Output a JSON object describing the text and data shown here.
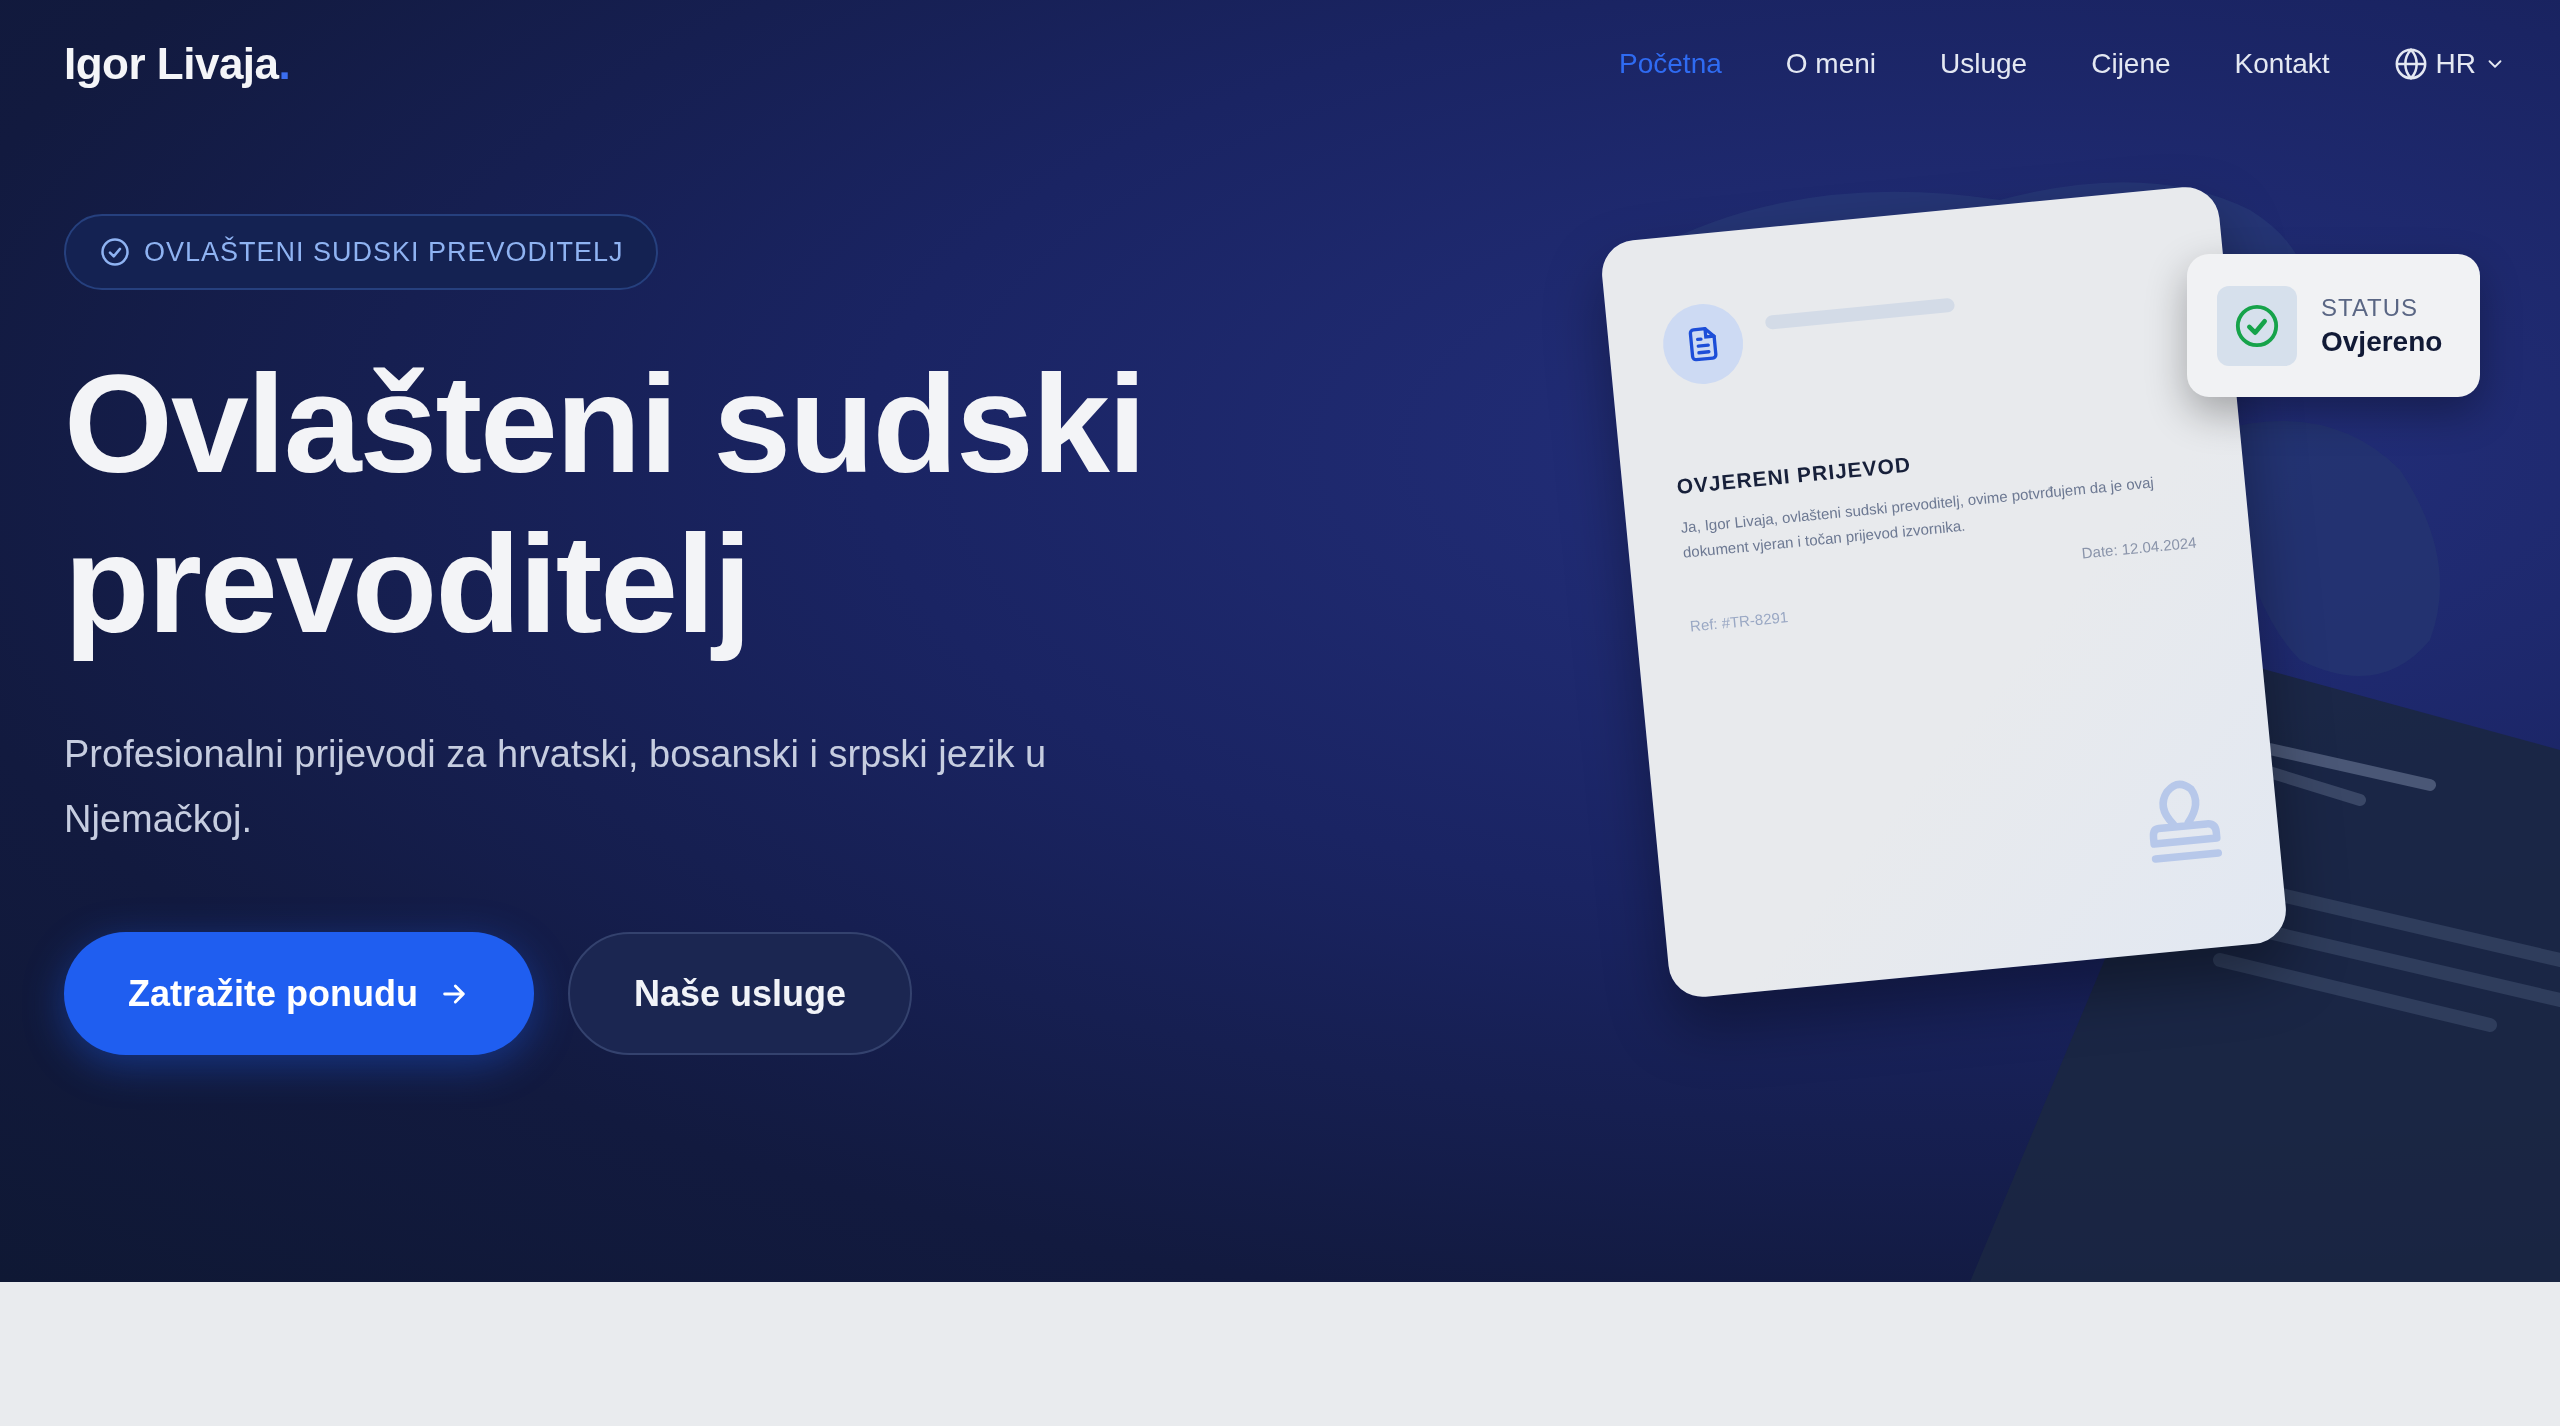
{
  "logo": {
    "text": "Igor Livaja",
    "dot": "."
  },
  "nav": {
    "items": [
      {
        "label": "Početna",
        "selected": true
      },
      {
        "label": "O meni",
        "selected": false
      },
      {
        "label": "Usluge",
        "selected": false
      },
      {
        "label": "Cijene",
        "selected": false
      },
      {
        "label": "Kontakt",
        "selected": false
      }
    ],
    "language": "HR"
  },
  "hero": {
    "badge": "OVLAŠTENI SUDSKI PREVODITELJ",
    "heading": [
      "Ovlašteni sudski",
      "prevoditelj"
    ],
    "subtitle": "Profesionalni prijevodi za hrvatski, bosanski i srpski jezik u Njemačkoj.",
    "buttons": [
      {
        "label": "Zatražite ponudu",
        "kind": "primary"
      },
      {
        "label": "Naše usluge",
        "kind": "secondary"
      }
    ]
  },
  "document": {
    "title": "OVJERENI PRIJEVOD",
    "text": "Ja, Igor Livaja, ovlašteni sudski prevoditelj, ovime potvrđujem da je ovaj dokument vjeran i točan prijevod izvornika.",
    "date": "Date: 12.04.2024",
    "ref": "Ref: #TR-8291"
  },
  "status": {
    "label": "STATUS",
    "value": "Ovjereno"
  }
}
